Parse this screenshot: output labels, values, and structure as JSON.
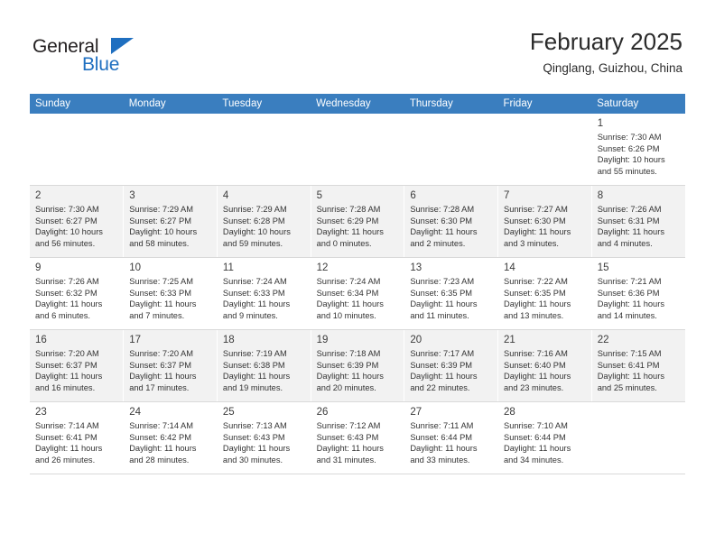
{
  "brand": {
    "word_one": "General",
    "word_two": "Blue",
    "triangle_icon": "triangle-icon",
    "accent_color": "#1f6fc0"
  },
  "header": {
    "title": "February 2025",
    "subtitle": "Qinglang, Guizhou, China"
  },
  "theme": {
    "header_row_bg": "#3a7ebf",
    "alt_row_bg": "#f2f2f2",
    "grid_line": "#d9d9d9"
  },
  "weekdays": [
    "Sunday",
    "Monday",
    "Tuesday",
    "Wednesday",
    "Thursday",
    "Friday",
    "Saturday"
  ],
  "labels": {
    "sunrise": "Sunrise:",
    "sunset": "Sunset:",
    "daylight": "Daylight:"
  },
  "weeks": [
    [
      {
        "day": "",
        "sunrise": "",
        "sunset": "",
        "daylight_line1": "",
        "daylight_line2": ""
      },
      {
        "day": "",
        "sunrise": "",
        "sunset": "",
        "daylight_line1": "",
        "daylight_line2": ""
      },
      {
        "day": "",
        "sunrise": "",
        "sunset": "",
        "daylight_line1": "",
        "daylight_line2": ""
      },
      {
        "day": "",
        "sunrise": "",
        "sunset": "",
        "daylight_line1": "",
        "daylight_line2": ""
      },
      {
        "day": "",
        "sunrise": "",
        "sunset": "",
        "daylight_line1": "",
        "daylight_line2": ""
      },
      {
        "day": "",
        "sunrise": "",
        "sunset": "",
        "daylight_line1": "",
        "daylight_line2": ""
      },
      {
        "day": "1",
        "sunrise": "Sunrise: 7:30 AM",
        "sunset": "Sunset: 6:26 PM",
        "daylight_line1": "Daylight: 10 hours",
        "daylight_line2": "and 55 minutes."
      }
    ],
    [
      {
        "day": "2",
        "sunrise": "Sunrise: 7:30 AM",
        "sunset": "Sunset: 6:27 PM",
        "daylight_line1": "Daylight: 10 hours",
        "daylight_line2": "and 56 minutes."
      },
      {
        "day": "3",
        "sunrise": "Sunrise: 7:29 AM",
        "sunset": "Sunset: 6:27 PM",
        "daylight_line1": "Daylight: 10 hours",
        "daylight_line2": "and 58 minutes."
      },
      {
        "day": "4",
        "sunrise": "Sunrise: 7:29 AM",
        "sunset": "Sunset: 6:28 PM",
        "daylight_line1": "Daylight: 10 hours",
        "daylight_line2": "and 59 minutes."
      },
      {
        "day": "5",
        "sunrise": "Sunrise: 7:28 AM",
        "sunset": "Sunset: 6:29 PM",
        "daylight_line1": "Daylight: 11 hours",
        "daylight_line2": "and 0 minutes."
      },
      {
        "day": "6",
        "sunrise": "Sunrise: 7:28 AM",
        "sunset": "Sunset: 6:30 PM",
        "daylight_line1": "Daylight: 11 hours",
        "daylight_line2": "and 2 minutes."
      },
      {
        "day": "7",
        "sunrise": "Sunrise: 7:27 AM",
        "sunset": "Sunset: 6:30 PM",
        "daylight_line1": "Daylight: 11 hours",
        "daylight_line2": "and 3 minutes."
      },
      {
        "day": "8",
        "sunrise": "Sunrise: 7:26 AM",
        "sunset": "Sunset: 6:31 PM",
        "daylight_line1": "Daylight: 11 hours",
        "daylight_line2": "and 4 minutes."
      }
    ],
    [
      {
        "day": "9",
        "sunrise": "Sunrise: 7:26 AM",
        "sunset": "Sunset: 6:32 PM",
        "daylight_line1": "Daylight: 11 hours",
        "daylight_line2": "and 6 minutes."
      },
      {
        "day": "10",
        "sunrise": "Sunrise: 7:25 AM",
        "sunset": "Sunset: 6:33 PM",
        "daylight_line1": "Daylight: 11 hours",
        "daylight_line2": "and 7 minutes."
      },
      {
        "day": "11",
        "sunrise": "Sunrise: 7:24 AM",
        "sunset": "Sunset: 6:33 PM",
        "daylight_line1": "Daylight: 11 hours",
        "daylight_line2": "and 9 minutes."
      },
      {
        "day": "12",
        "sunrise": "Sunrise: 7:24 AM",
        "sunset": "Sunset: 6:34 PM",
        "daylight_line1": "Daylight: 11 hours",
        "daylight_line2": "and 10 minutes."
      },
      {
        "day": "13",
        "sunrise": "Sunrise: 7:23 AM",
        "sunset": "Sunset: 6:35 PM",
        "daylight_line1": "Daylight: 11 hours",
        "daylight_line2": "and 11 minutes."
      },
      {
        "day": "14",
        "sunrise": "Sunrise: 7:22 AM",
        "sunset": "Sunset: 6:35 PM",
        "daylight_line1": "Daylight: 11 hours",
        "daylight_line2": "and 13 minutes."
      },
      {
        "day": "15",
        "sunrise": "Sunrise: 7:21 AM",
        "sunset": "Sunset: 6:36 PM",
        "daylight_line1": "Daylight: 11 hours",
        "daylight_line2": "and 14 minutes."
      }
    ],
    [
      {
        "day": "16",
        "sunrise": "Sunrise: 7:20 AM",
        "sunset": "Sunset: 6:37 PM",
        "daylight_line1": "Daylight: 11 hours",
        "daylight_line2": "and 16 minutes."
      },
      {
        "day": "17",
        "sunrise": "Sunrise: 7:20 AM",
        "sunset": "Sunset: 6:37 PM",
        "daylight_line1": "Daylight: 11 hours",
        "daylight_line2": "and 17 minutes."
      },
      {
        "day": "18",
        "sunrise": "Sunrise: 7:19 AM",
        "sunset": "Sunset: 6:38 PM",
        "daylight_line1": "Daylight: 11 hours",
        "daylight_line2": "and 19 minutes."
      },
      {
        "day": "19",
        "sunrise": "Sunrise: 7:18 AM",
        "sunset": "Sunset: 6:39 PM",
        "daylight_line1": "Daylight: 11 hours",
        "daylight_line2": "and 20 minutes."
      },
      {
        "day": "20",
        "sunrise": "Sunrise: 7:17 AM",
        "sunset": "Sunset: 6:39 PM",
        "daylight_line1": "Daylight: 11 hours",
        "daylight_line2": "and 22 minutes."
      },
      {
        "day": "21",
        "sunrise": "Sunrise: 7:16 AM",
        "sunset": "Sunset: 6:40 PM",
        "daylight_line1": "Daylight: 11 hours",
        "daylight_line2": "and 23 minutes."
      },
      {
        "day": "22",
        "sunrise": "Sunrise: 7:15 AM",
        "sunset": "Sunset: 6:41 PM",
        "daylight_line1": "Daylight: 11 hours",
        "daylight_line2": "and 25 minutes."
      }
    ],
    [
      {
        "day": "23",
        "sunrise": "Sunrise: 7:14 AM",
        "sunset": "Sunset: 6:41 PM",
        "daylight_line1": "Daylight: 11 hours",
        "daylight_line2": "and 26 minutes."
      },
      {
        "day": "24",
        "sunrise": "Sunrise: 7:14 AM",
        "sunset": "Sunset: 6:42 PM",
        "daylight_line1": "Daylight: 11 hours",
        "daylight_line2": "and 28 minutes."
      },
      {
        "day": "25",
        "sunrise": "Sunrise: 7:13 AM",
        "sunset": "Sunset: 6:43 PM",
        "daylight_line1": "Daylight: 11 hours",
        "daylight_line2": "and 30 minutes."
      },
      {
        "day": "26",
        "sunrise": "Sunrise: 7:12 AM",
        "sunset": "Sunset: 6:43 PM",
        "daylight_line1": "Daylight: 11 hours",
        "daylight_line2": "and 31 minutes."
      },
      {
        "day": "27",
        "sunrise": "Sunrise: 7:11 AM",
        "sunset": "Sunset: 6:44 PM",
        "daylight_line1": "Daylight: 11 hours",
        "daylight_line2": "and 33 minutes."
      },
      {
        "day": "28",
        "sunrise": "Sunrise: 7:10 AM",
        "sunset": "Sunset: 6:44 PM",
        "daylight_line1": "Daylight: 11 hours",
        "daylight_line2": "and 34 minutes."
      },
      {
        "day": "",
        "sunrise": "",
        "sunset": "",
        "daylight_line1": "",
        "daylight_line2": ""
      }
    ]
  ]
}
